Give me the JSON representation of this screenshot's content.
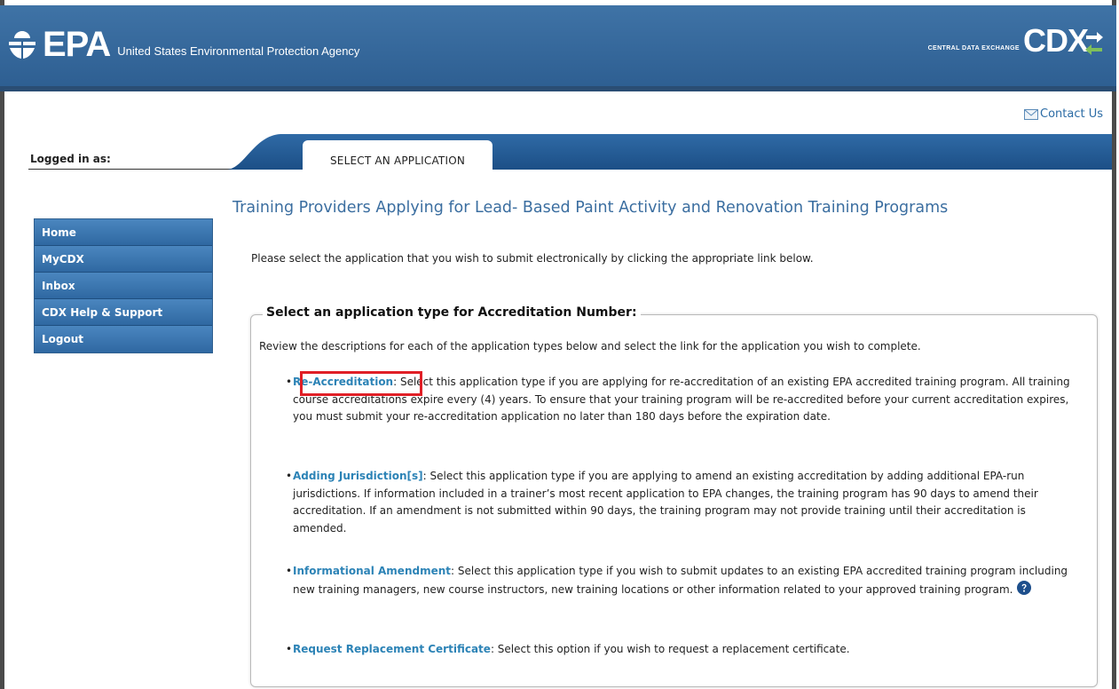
{
  "header": {
    "epa_logo_text": "EPA",
    "agency_name": "United States Environmental Protection Agency",
    "cdx_subtitle": "CENTRAL DATA EXCHANGE",
    "cdx_logo_text": "CDX"
  },
  "contact_us": "Contact Us",
  "logged_in_label": "Logged in as:",
  "tab": {
    "label": "SELECT AN APPLICATION"
  },
  "sidebar": {
    "items": [
      {
        "label": "Home"
      },
      {
        "label": "MyCDX"
      },
      {
        "label": "Inbox"
      },
      {
        "label": "CDX Help & Support"
      },
      {
        "label": "Logout"
      }
    ]
  },
  "main": {
    "title": "Training Providers Applying for Lead- Based Paint Activity and Renovation Training Programs",
    "instructions": "Please select the application that you wish to submit electronically by clicking the appropriate link below.",
    "legend": "Select an application type for Accreditation Number:",
    "review": "Review the descriptions for each of the application types below and select the link for the application you wish to complete.",
    "options": [
      {
        "link": "Re-Accreditation",
        "text": ": Select this application type if you are applying for re-accreditation of an existing EPA accredited training program. All training course accreditations expire every (4) years. To ensure that your training program will be re-accredited before your current accreditation expires, you must submit your re-accreditation application no later than 180 days before the expiration date."
      },
      {
        "link": "Adding Jurisdiction[s]",
        "text": ": Select this application type if you are applying to amend an existing accreditation by adding additional EPA-run jurisdictions. If information included in a trainer’s most recent application to EPA changes, the training program has 90 days to amend their accreditation. If an amendment is not submitted within 90 days, the training program may not provide training until their accreditation is amended."
      },
      {
        "link": "Informational Amendment",
        "text": ": Select this application type if you wish to submit updates to an existing EPA accredited training program including new training managers, new course instructors, new training locations or other information related to your approved training program."
      },
      {
        "link": "Request Replacement Certificate",
        "text": ": Select this option if you wish to request a replacement certificate."
      }
    ]
  },
  "colors": {
    "header_blue": "#3a6c9f",
    "link_blue": "#2c83b6",
    "highlight_red": "#e01f26"
  }
}
